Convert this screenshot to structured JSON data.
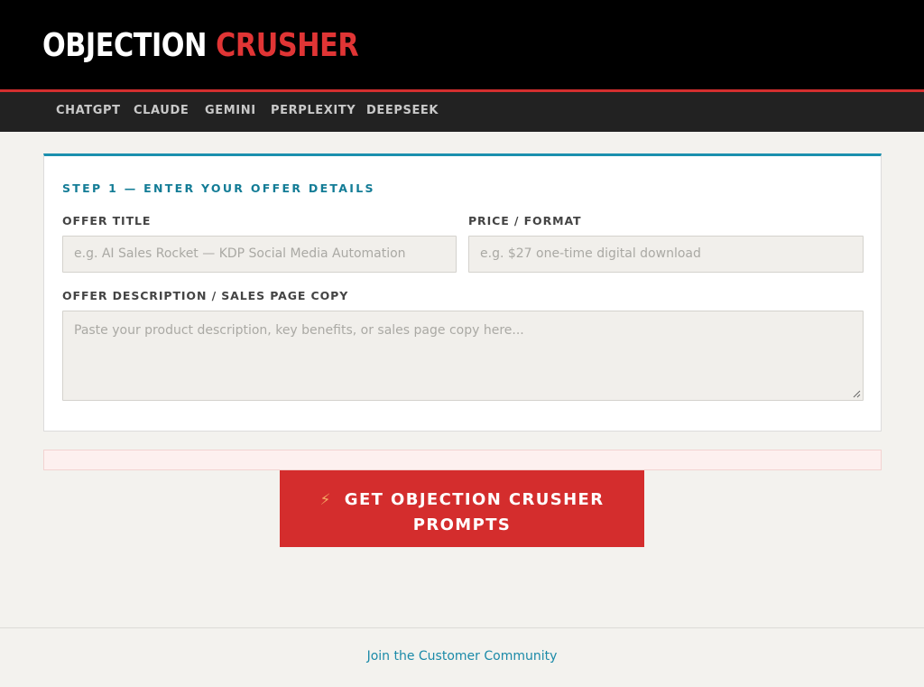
{
  "header": {
    "logo_part1": "OBJECTION",
    "logo_part2": "CRUSHER"
  },
  "nav": {
    "items": [
      {
        "label": "CHATGPT"
      },
      {
        "label": "CLAUDE"
      },
      {
        "label": "GEMINI"
      },
      {
        "label": "PERPLEXITY"
      },
      {
        "label": "DEEPSEEK"
      }
    ]
  },
  "form": {
    "step_title": "STEP 1 — ENTER YOUR OFFER DETAILS",
    "offer_title": {
      "label": "OFFER TITLE",
      "placeholder": "e.g. AI Sales Rocket — KDP Social Media Automation",
      "value": ""
    },
    "price_format": {
      "label": "PRICE / FORMAT",
      "placeholder": "e.g. $27 one-time digital download",
      "value": ""
    },
    "description": {
      "label": "OFFER DESCRIPTION / SALES PAGE COPY",
      "placeholder": "Paste your product description, key benefits, or sales page copy here...",
      "value": ""
    }
  },
  "cta": {
    "icon": "lightning-bolt-icon",
    "label_line1": "GET OBJECTION CRUSHER",
    "label_line2": "PROMPTS"
  },
  "footer": {
    "link_label": "Join the Customer Community"
  },
  "colors": {
    "brand_red": "#d42d2d",
    "accent_teal": "#1b90ae",
    "header_bg": "#000000",
    "nav_bg": "#222222",
    "page_bg": "#f3f2ee"
  }
}
